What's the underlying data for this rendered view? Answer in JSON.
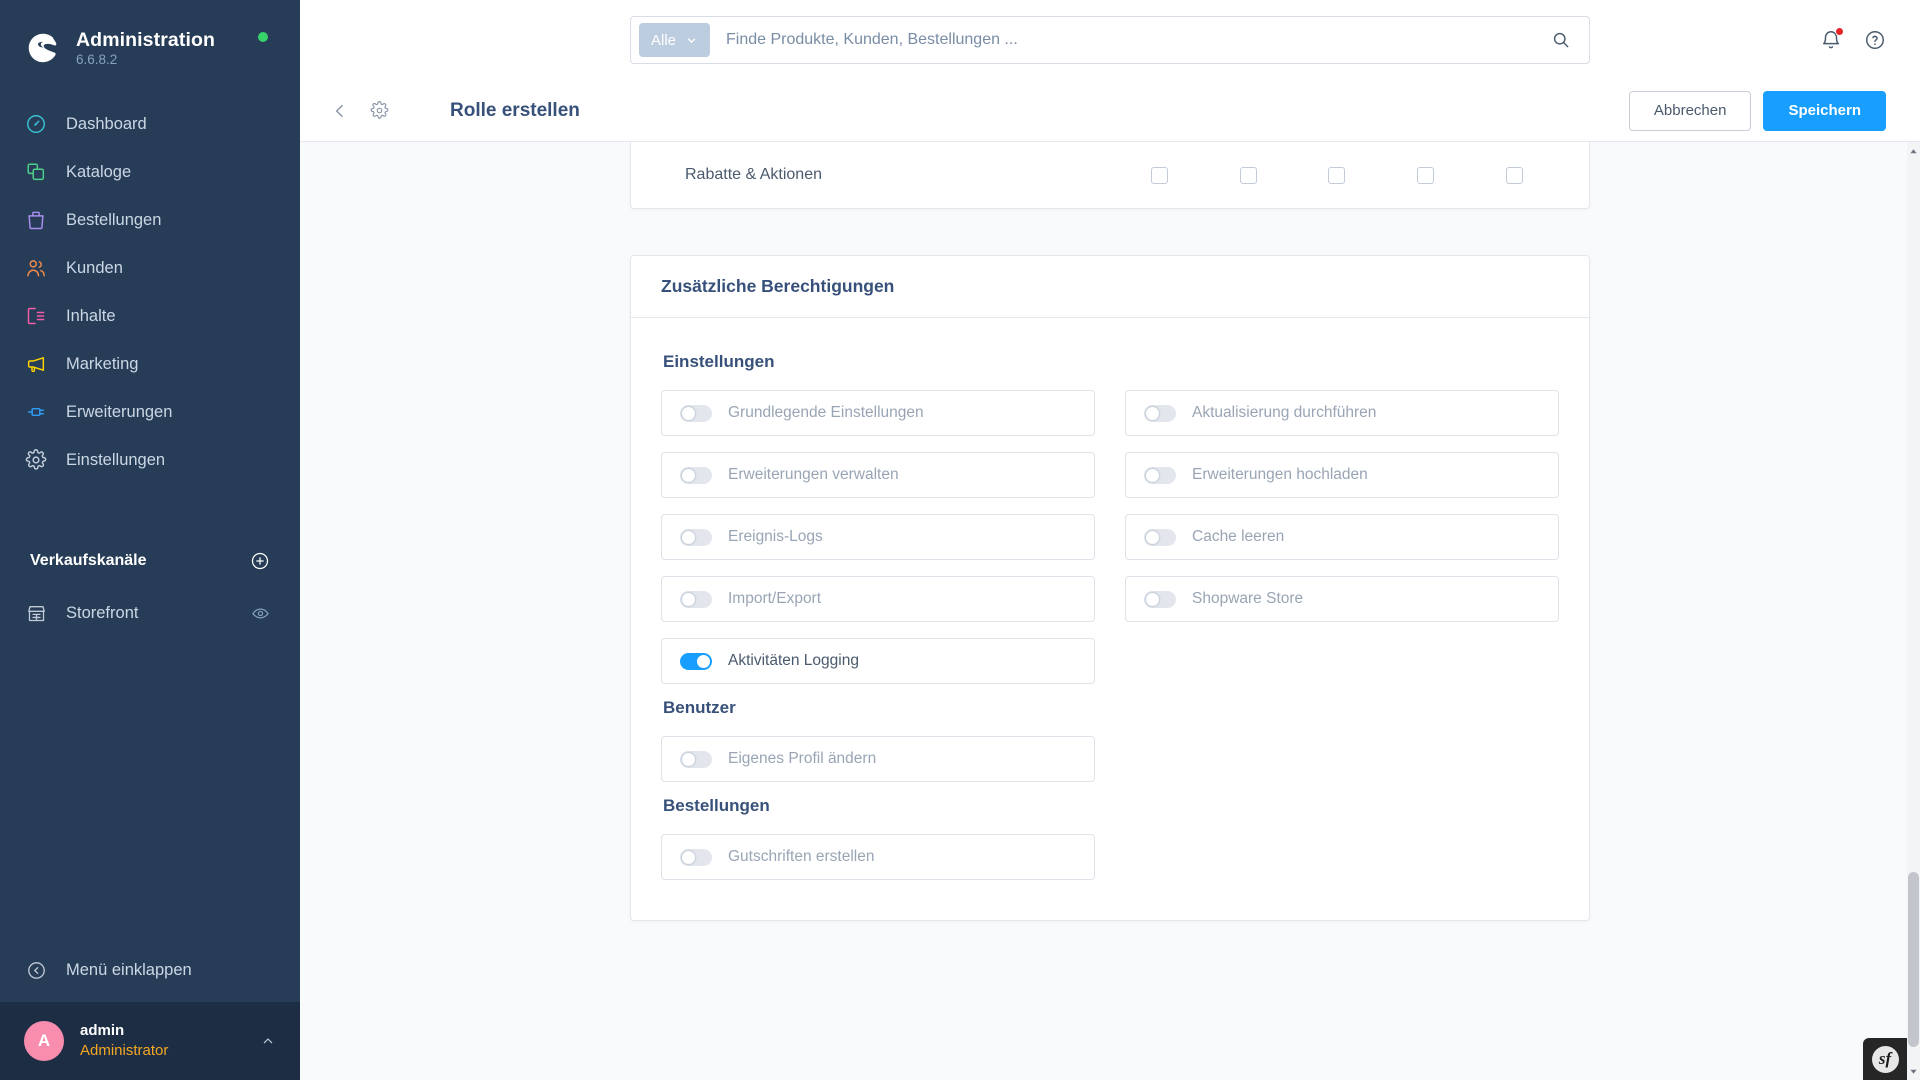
{
  "sidebar": {
    "brand": {
      "title": "Administration",
      "version": "6.6.8.2",
      "status_icon": "status-dot-online",
      "status_color": "#37d26a",
      "logo_icon": "shopware-logo-icon"
    },
    "nav_items": [
      {
        "label": "Dashboard",
        "icon": "dashboard-icon",
        "color": "#3bbfd6"
      },
      {
        "label": "Kataloge",
        "icon": "catalog-icon",
        "color": "#4ed08a"
      },
      {
        "label": "Bestellungen",
        "icon": "orders-bag-icon",
        "color": "#a88ff0"
      },
      {
        "label": "Kunden",
        "icon": "customers-icon",
        "color": "#f08a4b"
      },
      {
        "label": "Inhalte",
        "icon": "content-icon",
        "color": "#f35ca8"
      },
      {
        "label": "Marketing",
        "icon": "megaphone-icon",
        "color": "#ffd400"
      },
      {
        "label": "Erweiterungen",
        "icon": "plugin-icon",
        "color": "#2f9bf5"
      },
      {
        "label": "Einstellungen",
        "icon": "gear-icon",
        "color": "#c2ccd9"
      }
    ],
    "sales_channels": {
      "title": "Verkaufskanäle",
      "add_icon": "plus-circle-icon",
      "items": [
        {
          "label": "Storefront",
          "icon": "storefront-icon",
          "action_icon": "eye-icon"
        }
      ]
    },
    "collapse": {
      "label": "Menü einklappen",
      "icon": "collapse-left-icon"
    },
    "user": {
      "avatar_initial": "A",
      "avatar_color": "#f88dae",
      "name": "admin",
      "role": "Administrator",
      "chevron_icon": "chevron-up-icon"
    }
  },
  "topbar": {
    "search": {
      "scope_label": "Alle",
      "scope_chevron_icon": "chevron-down-icon",
      "placeholder": "Finde Produkte, Kunden, Bestellungen ...",
      "value": "",
      "submit_icon": "search-icon"
    },
    "notifications": {
      "icon": "bell-icon",
      "has_badge": true,
      "badge_color": "#e52427"
    },
    "help": {
      "icon": "help-circle-icon"
    }
  },
  "smartbar": {
    "back_icon": "chevron-left-icon",
    "settings_icon": "gear-icon",
    "title": "Rolle erstellen",
    "cancel_label": "Abbrechen",
    "save_label": "Speichern",
    "primary_color": "#189eff"
  },
  "permissions_partial": {
    "rows": [
      {
        "label": "Rabatte & Aktionen",
        "checkboxes": [
          false,
          false,
          false,
          false,
          false
        ]
      }
    ]
  },
  "additional_permissions": {
    "card_title": "Zusätzliche Berechtigungen",
    "groups": [
      {
        "title": "Einstellungen",
        "toggles": [
          {
            "label": "Grundlegende Einstellungen",
            "on": false
          },
          {
            "label": "Aktualisierung durchführen",
            "on": false
          },
          {
            "label": "Erweiterungen verwalten",
            "on": false
          },
          {
            "label": "Erweiterungen hochladen",
            "on": false
          },
          {
            "label": "Ereignis-Logs",
            "on": false
          },
          {
            "label": "Cache leeren",
            "on": false
          },
          {
            "label": "Import/Export",
            "on": false
          },
          {
            "label": "Shopware Store",
            "on": false
          },
          {
            "label": "Aktivitäten Logging",
            "on": true
          }
        ]
      },
      {
        "title": "Benutzer",
        "toggles": [
          {
            "label": "Eigenes Profil ändern",
            "on": false
          }
        ]
      },
      {
        "title": "Bestellungen",
        "toggles": [
          {
            "label": "Gutschriften erstellen",
            "on": false
          }
        ]
      }
    ]
  },
  "scrollbar": {
    "up_arrow_icon": "caret-up-icon",
    "down_arrow_icon": "caret-down-icon"
  },
  "debug_toolbar": {
    "label": "sf",
    "icon": "symfony-logo-icon"
  }
}
